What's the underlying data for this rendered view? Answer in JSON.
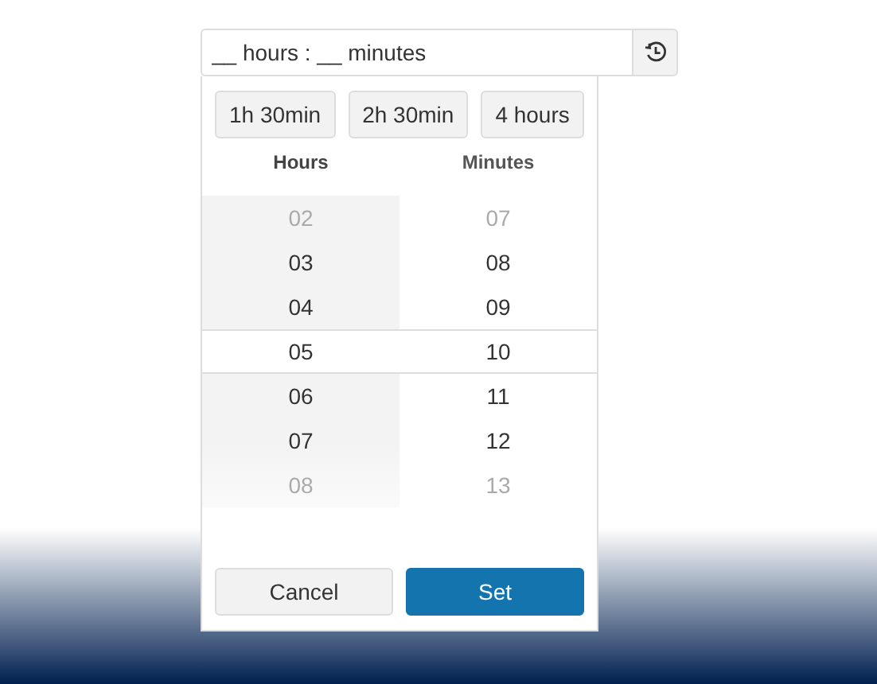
{
  "field": {
    "placeholder": "__ hours : __ minutes"
  },
  "presets": [
    "1h 30min",
    "2h 30min",
    "4 hours"
  ],
  "columns": [
    {
      "heading": "Hours",
      "items": [
        {
          "label": "02",
          "selected": false
        },
        {
          "label": "03",
          "selected": false
        },
        {
          "label": "04",
          "selected": false
        },
        {
          "label": "05",
          "selected": true
        },
        {
          "label": "06",
          "selected": false
        },
        {
          "label": "07",
          "selected": false
        },
        {
          "label": "08",
          "selected": false
        }
      ]
    },
    {
      "heading": "Minutes",
      "items": [
        {
          "label": "07",
          "selected": false
        },
        {
          "label": "08",
          "selected": false
        },
        {
          "label": "09",
          "selected": false
        },
        {
          "label": "10",
          "selected": true
        },
        {
          "label": "11",
          "selected": false
        },
        {
          "label": "12",
          "selected": false
        },
        {
          "label": "13",
          "selected": false
        }
      ]
    }
  ],
  "buttons": [
    {
      "label": "Cancel",
      "kind": "secondary"
    },
    {
      "label": "Set",
      "kind": "primary"
    }
  ]
}
